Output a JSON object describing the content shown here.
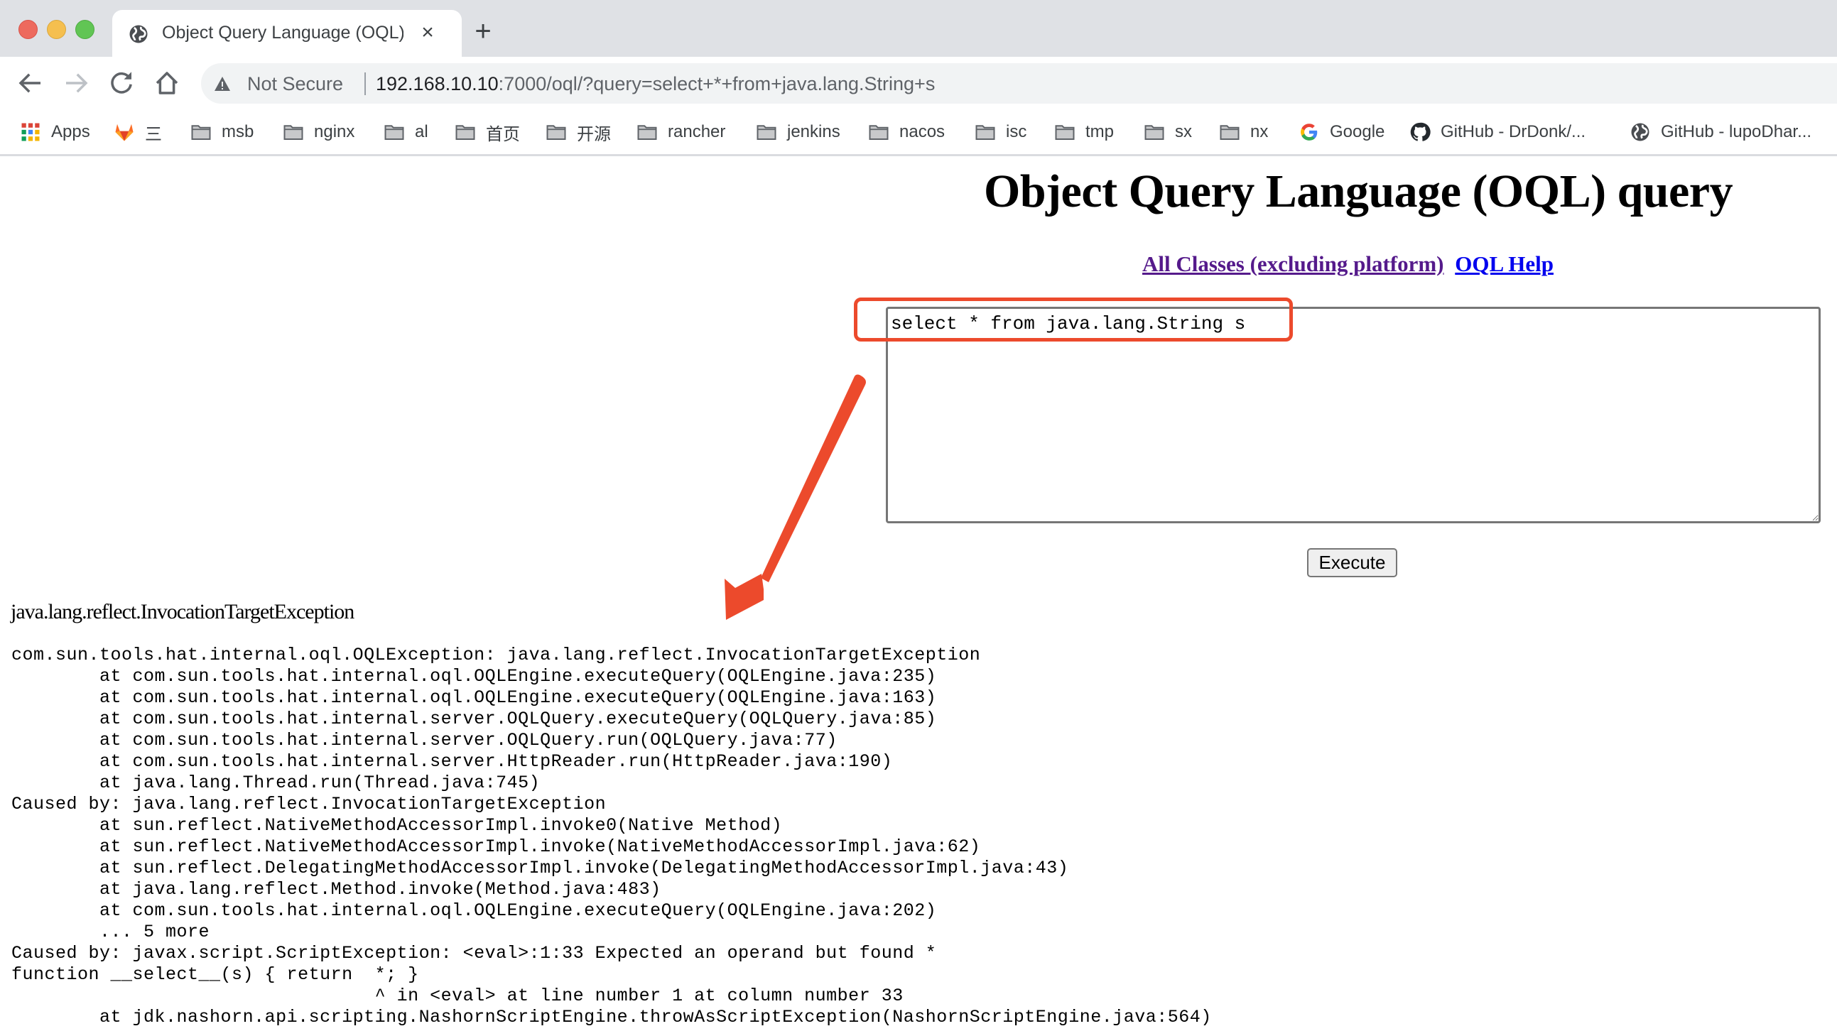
{
  "browser": {
    "tab": {
      "title": "Object Query Language (OQL) query",
      "close_label": "×"
    },
    "new_tab_label": "+",
    "omnibox": {
      "security_label": "Not Secure",
      "url_host": "192.168.10.10",
      "url_rest": ":7000/oql/?query=select+*+from+java.lang.String+s"
    },
    "bookmarks": [
      {
        "icon": "apps-grid-icon",
        "label": "Apps"
      },
      {
        "icon": "gitlab-icon",
        "label": "三"
      },
      {
        "icon": "folder-icon",
        "label": "msb"
      },
      {
        "icon": "folder-icon",
        "label": "nginx"
      },
      {
        "icon": "folder-icon",
        "label": "al"
      },
      {
        "icon": "folder-icon",
        "label": "首页"
      },
      {
        "icon": "folder-icon",
        "label": "开源"
      },
      {
        "icon": "folder-icon",
        "label": "rancher"
      },
      {
        "icon": "folder-icon",
        "label": "jenkins"
      },
      {
        "icon": "folder-icon",
        "label": "nacos"
      },
      {
        "icon": "folder-icon",
        "label": "isc"
      },
      {
        "icon": "folder-icon",
        "label": "tmp"
      },
      {
        "icon": "folder-icon",
        "label": "sx"
      },
      {
        "icon": "folder-icon",
        "label": "nx"
      },
      {
        "icon": "google-icon",
        "label": "Google"
      },
      {
        "icon": "github-icon",
        "label": "GitHub - DrDonk/..."
      },
      {
        "icon": "globe-icon",
        "label": "GitHub - lupoDhar..."
      }
    ]
  },
  "page": {
    "title": "Object Query Language (OQL) query",
    "links": {
      "all_classes": "All Classes (excluding platform)",
      "oql_help": "OQL Help"
    },
    "query": {
      "value": "select * from java.lang.String s"
    },
    "execute_label": "Execute",
    "error_heading": "java.lang.reflect.InvocationTargetException",
    "stacktrace": [
      "com.sun.tools.hat.internal.oql.OQLException: java.lang.reflect.InvocationTargetException",
      "\tat com.sun.tools.hat.internal.oql.OQLEngine.executeQuery(OQLEngine.java:235)",
      "\tat com.sun.tools.hat.internal.oql.OQLEngine.executeQuery(OQLEngine.java:163)",
      "\tat com.sun.tools.hat.internal.server.OQLQuery.executeQuery(OQLQuery.java:85)",
      "\tat com.sun.tools.hat.internal.server.OQLQuery.run(OQLQuery.java:77)",
      "\tat com.sun.tools.hat.internal.server.HttpReader.run(HttpReader.java:190)",
      "\tat java.lang.Thread.run(Thread.java:745)",
      "Caused by: java.lang.reflect.InvocationTargetException",
      "\tat sun.reflect.NativeMethodAccessorImpl.invoke0(Native Method)",
      "\tat sun.reflect.NativeMethodAccessorImpl.invoke(NativeMethodAccessorImpl.java:62)",
      "\tat sun.reflect.DelegatingMethodAccessorImpl.invoke(DelegatingMethodAccessorImpl.java:43)",
      "\tat java.lang.reflect.Method.invoke(Method.java:483)",
      "\tat com.sun.tools.hat.internal.oql.OQLEngine.executeQuery(OQLEngine.java:202)",
      "\t... 5 more",
      "Caused by: javax.script.ScriptException: <eval>:1:33 Expected an operand but found *",
      "function __select__(s) { return  *; }",
      "                                 ^ in <eval> at line number 1 at column number 33",
      "\tat jdk.nashorn.api.scripting.NashornScriptEngine.throwAsScriptException(NashornScriptEngine.java:564)"
    ]
  },
  "annotation": {
    "color": "#ec4a2c"
  }
}
